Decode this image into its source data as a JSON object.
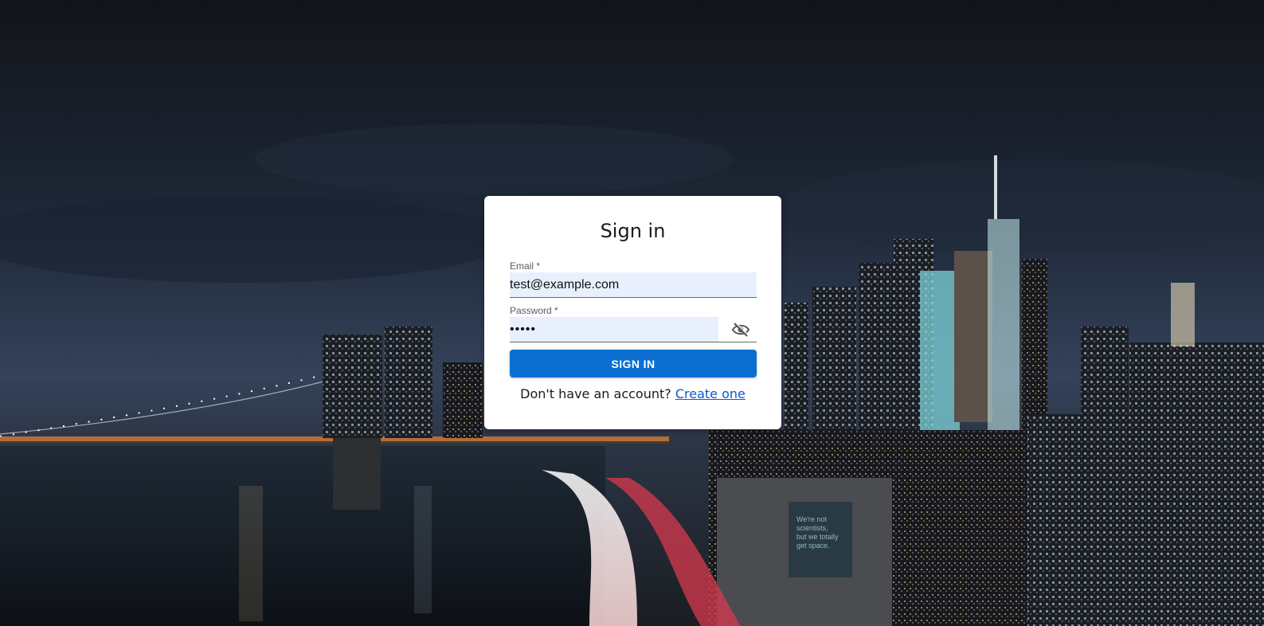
{
  "form": {
    "title": "Sign in",
    "email_label": "Email *",
    "email_value": "test@example.com",
    "password_label": "Password *",
    "password_value": "12345",
    "submit_label": "SIGN IN",
    "no_account_text": "Don't have an account?",
    "create_link_label": "Create one",
    "toggle_visibility_icon": "eye-off-icon"
  },
  "background": {
    "billboard_lines": [
      "We're not",
      "scientists,",
      "but we totally",
      "get space."
    ]
  },
  "colors": {
    "primary": "#0b6fd1",
    "link": "#0b57d0",
    "field_fill": "#e8f0fe"
  }
}
